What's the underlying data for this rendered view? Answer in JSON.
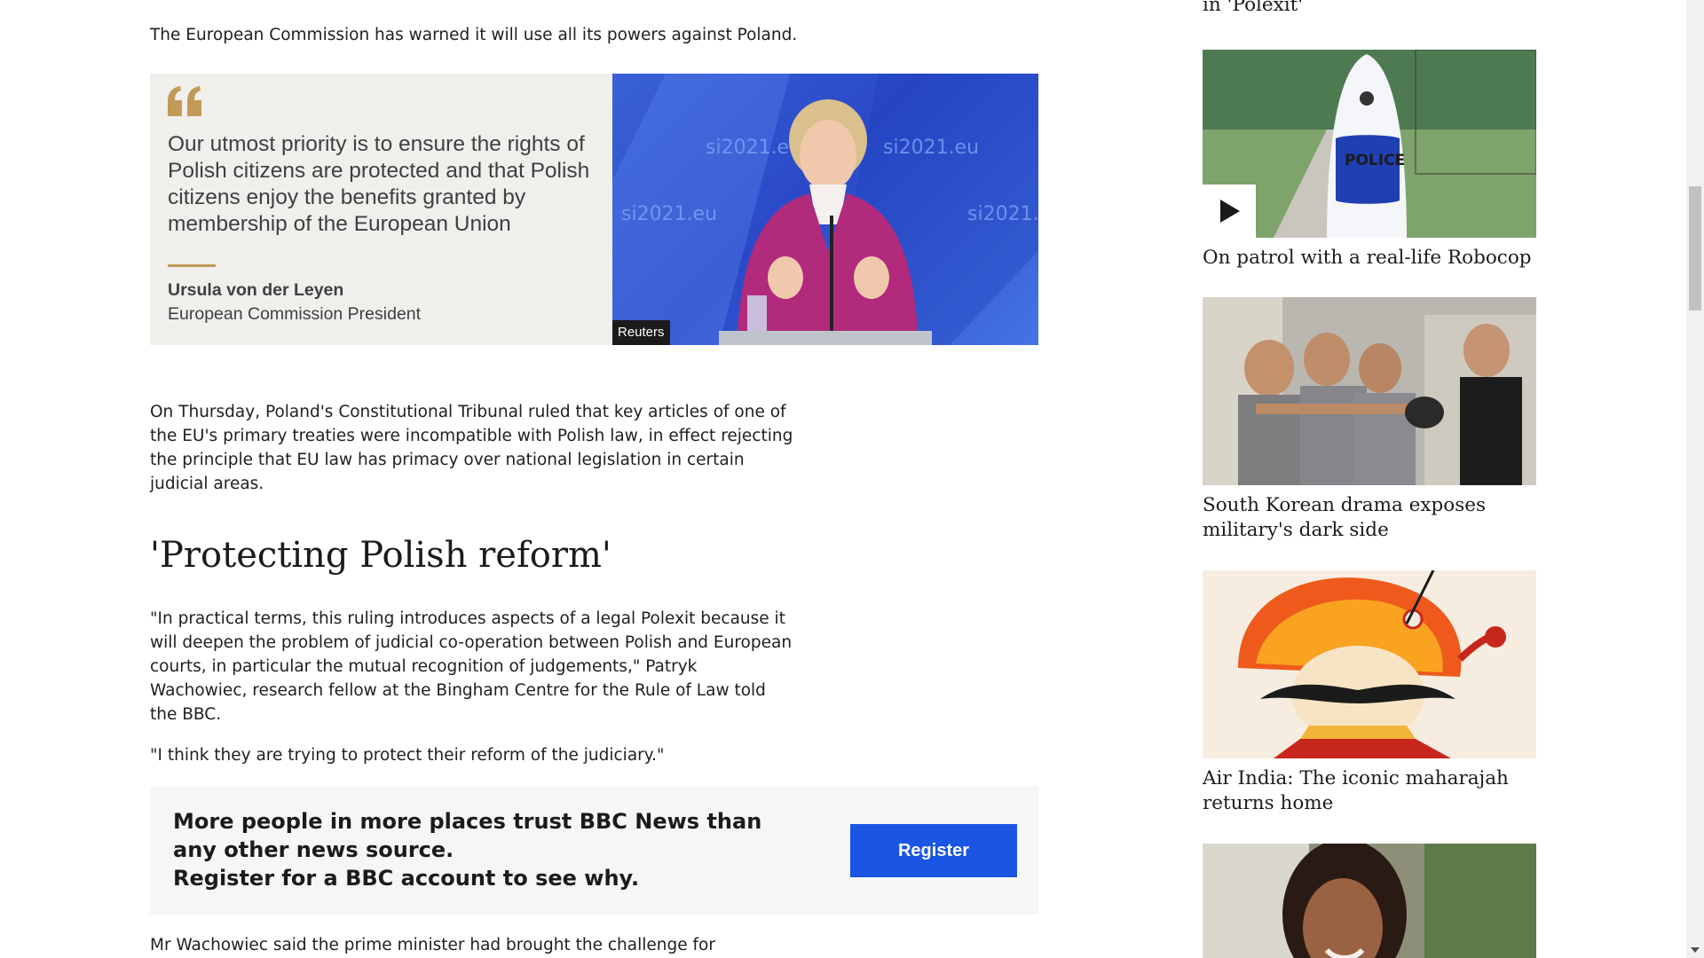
{
  "article": {
    "intro_paragraph": "The European Commission has warned it will use all its powers against Poland.",
    "quote": {
      "text": "Our utmost priority is to ensure the rights of Polish citizens are protected and that Polish citizens enjoy the benefits granted by membership of the European Union",
      "author": "Ursula von der Leyen",
      "role": "European Commission President",
      "image_credit": "Reuters",
      "image_backdrop_text": "si2021.eu"
    },
    "thursday_paragraph": "On Thursday, Poland's Constitutional Tribunal ruled that key articles of one of the EU's primary treaties were incompatible with Polish law, in effect rejecting the principle that EU law has primacy over national legislation in certain judicial areas.",
    "subheading": "'Protecting Polish reform'",
    "practical_paragraph": "\"In practical terms, this ruling introduces aspects of a legal Polexit because it will deepen the problem of judicial co-operation between Polish and European courts, in particular the mutual recognition of judgements,\" Patryk Wachowiec, research fellow at the Bingham Centre for the Rule of Law told the BBC.",
    "think_paragraph": "\"I think they are trying to protect their reform of the judiciary.\"",
    "promo": {
      "line1": "More people in more places trust BBC News than any other news source.",
      "line2": "Register for a BBC account to see why.",
      "button_label": "Register"
    },
    "last_paragraph": "Mr Wachowiec said the prime minister had brought the challenge for"
  },
  "sidebar": {
    "top_fragment": "in 'Polexit'",
    "cards": [
      {
        "title": "On patrol with a real-life Robocop",
        "image": "robocop-image",
        "has_play": true,
        "image_text": "POLICE"
      },
      {
        "title": "South Korean drama exposes military's dark side",
        "image": "military-drama-image",
        "has_play": false
      },
      {
        "title": "Air India: The iconic maharajah returns home",
        "image": "maharajah-image",
        "has_play": false
      },
      {
        "title": "",
        "image": "woman-portrait-image",
        "has_play": false
      }
    ]
  },
  "colors": {
    "accent_gold": "#c29a57",
    "register_blue": "#1a55e3",
    "quote_bg": "#f1efec",
    "promo_bg": "#f6f6f6"
  }
}
